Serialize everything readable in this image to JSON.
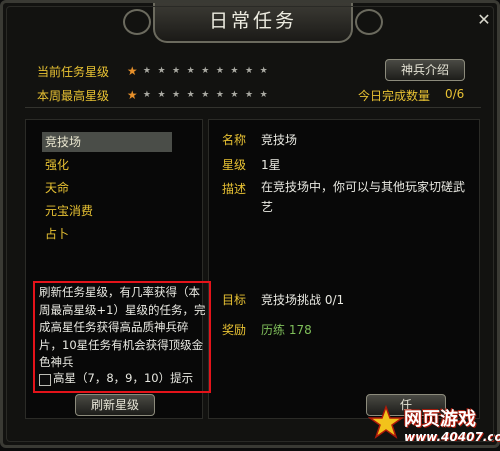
{
  "window": {
    "title": "日常任务",
    "close_glyph": "✕"
  },
  "star_rows": [
    {
      "label": "当前任务星级",
      "rating": 1,
      "max": 10
    },
    {
      "label": "本周最高星级",
      "rating": 1,
      "max": 10
    }
  ],
  "buttons": {
    "soldier_intro": "神兵介绍",
    "refresh_stars": "刷新星级",
    "accept_partial": "任"
  },
  "completed": {
    "label": "今日完成数量",
    "value": "0/6"
  },
  "task_list": [
    "竞技场",
    "强化",
    "天命",
    "元宝消费",
    "占卜"
  ],
  "selected_task_index": 0,
  "help": {
    "text": "刷新任务星级，有几率获得（本周最高星级+1）星级的任务，完成高星任务获得高品质神兵碎片，10星任务有机会获得顶级金色神兵",
    "checkbox_label": "高星（7，8，9，10）提示",
    "checked": false
  },
  "detail": {
    "name_label": "名称",
    "name": "竞技场",
    "star_label": "星级",
    "star": "1星",
    "desc_label": "描述",
    "desc": "在竞技场中，你可以与其他玩家切磋武艺",
    "target_label": "目标",
    "target": "竞技场挑战 0/1",
    "reward_label": "奖励",
    "reward": "历练 178"
  },
  "watermark": {
    "text": "网页游戏",
    "url": "www.40407.com"
  },
  "colors": {
    "gold": "#e8c233",
    "star_on": "#e7902a",
    "highlight_border": "#e4131a",
    "reward": "#7fbf5a"
  }
}
